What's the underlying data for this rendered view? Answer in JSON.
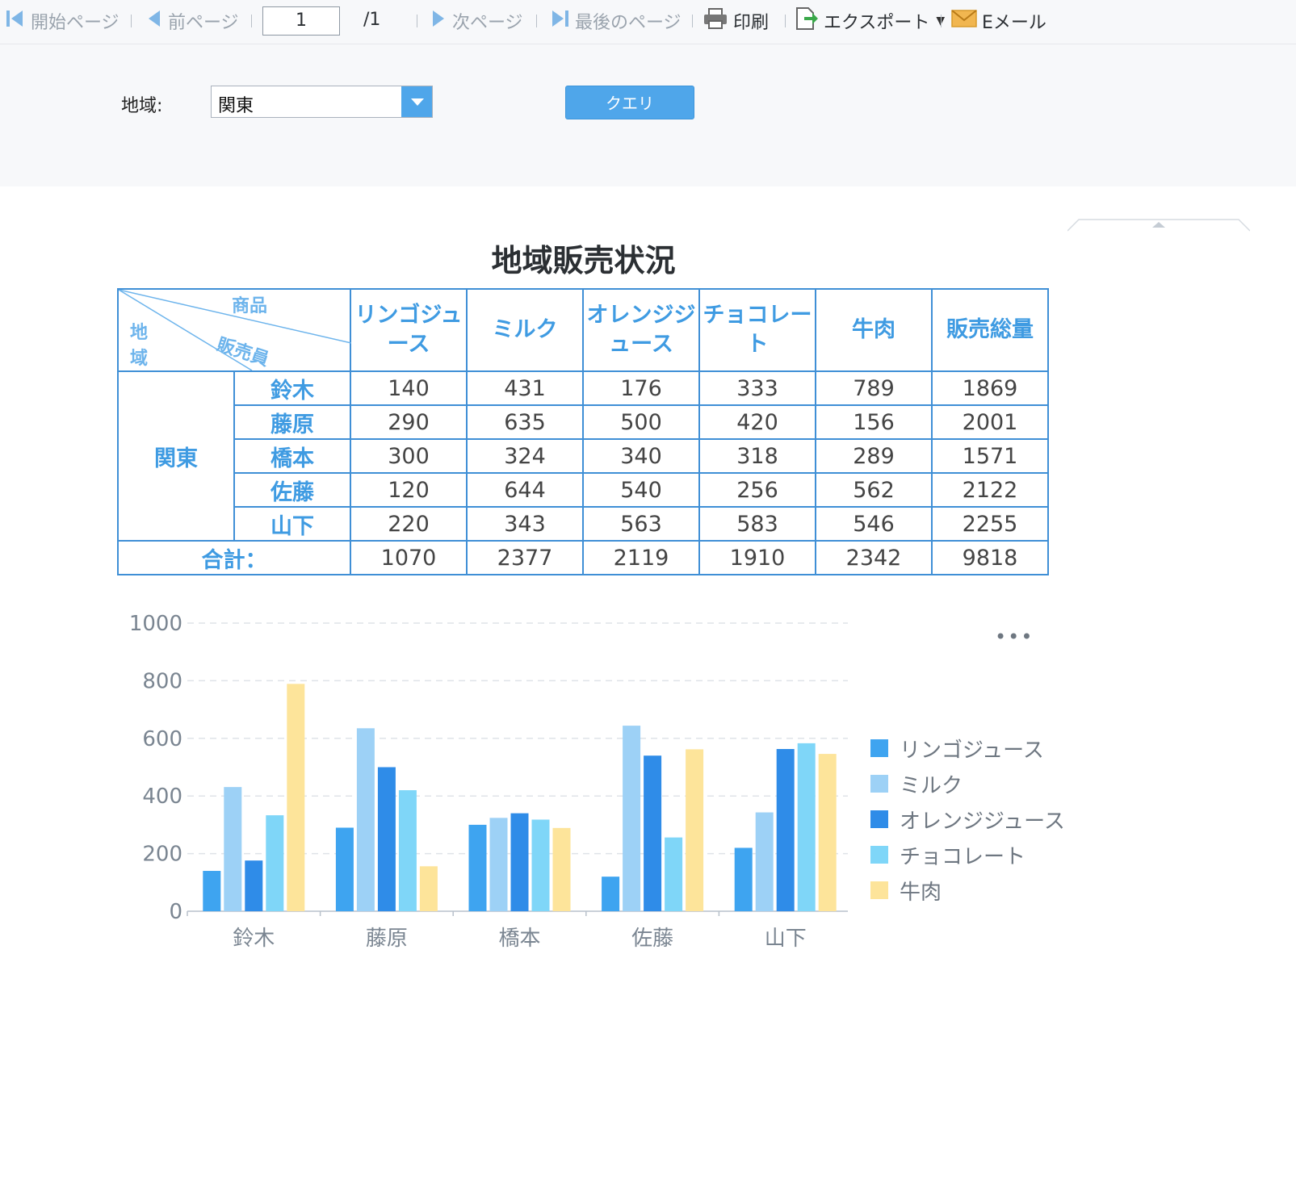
{
  "toolbar": {
    "first_page": "開始ページ",
    "prev_page": "前ページ",
    "page_number": "1",
    "page_total": "/1",
    "next_page": "次ページ",
    "last_page": "最後のページ",
    "print": "印刷",
    "export": "エクスポート",
    "email": "Eメール"
  },
  "params": {
    "region_label": "地域:",
    "region_value": "関東",
    "query_button": "クエリ"
  },
  "report": {
    "title": "地域販売状況",
    "corner": {
      "item": "商品",
      "sales": "販売員",
      "region": "地域"
    },
    "headers": [
      "リンゴジュース",
      "ミルク",
      "オレンジジュース",
      "チョコレート",
      "牛肉",
      "販売総量"
    ],
    "region": "関東",
    "rows": [
      {
        "name": "鈴木",
        "values": [
          "140",
          "431",
          "176",
          "333",
          "789",
          "1869"
        ]
      },
      {
        "name": "藤原",
        "values": [
          "290",
          "635",
          "500",
          "420",
          "156",
          "2001"
        ]
      },
      {
        "name": "橋本",
        "values": [
          "300",
          "324",
          "340",
          "318",
          "289",
          "1571"
        ]
      },
      {
        "name": "佐藤",
        "values": [
          "120",
          "644",
          "540",
          "256",
          "562",
          "2122"
        ]
      },
      {
        "name": "山下",
        "values": [
          "220",
          "343",
          "563",
          "583",
          "546",
          "2255"
        ]
      }
    ],
    "total_label": "合計：",
    "totals": [
      "1070",
      "2377",
      "2119",
      "1910",
      "2342",
      "9818"
    ]
  },
  "chart_more": "•••",
  "chart_data": {
    "type": "bar",
    "categories": [
      "鈴木",
      "藤原",
      "橋本",
      "佐藤",
      "山下"
    ],
    "series": [
      {
        "name": "リンゴジュース",
        "values": [
          140,
          290,
          300,
          120,
          220
        ],
        "color": "#3ea4f0"
      },
      {
        "name": "ミルク",
        "values": [
          431,
          635,
          324,
          644,
          343
        ],
        "color": "#9dd1f6"
      },
      {
        "name": "オレンジジュース",
        "values": [
          176,
          500,
          340,
          540,
          563
        ],
        "color": "#2f8ce8"
      },
      {
        "name": "チョコレート",
        "values": [
          333,
          420,
          318,
          256,
          583
        ],
        "color": "#7fd6f8"
      },
      {
        "name": "牛肉",
        "values": [
          789,
          156,
          289,
          562,
          546
        ],
        "color": "#fde49a"
      }
    ],
    "ylim": [
      0,
      1000
    ],
    "yticks": [
      0,
      200,
      400,
      600,
      800,
      1000
    ],
    "grid": true,
    "legend": "right"
  }
}
